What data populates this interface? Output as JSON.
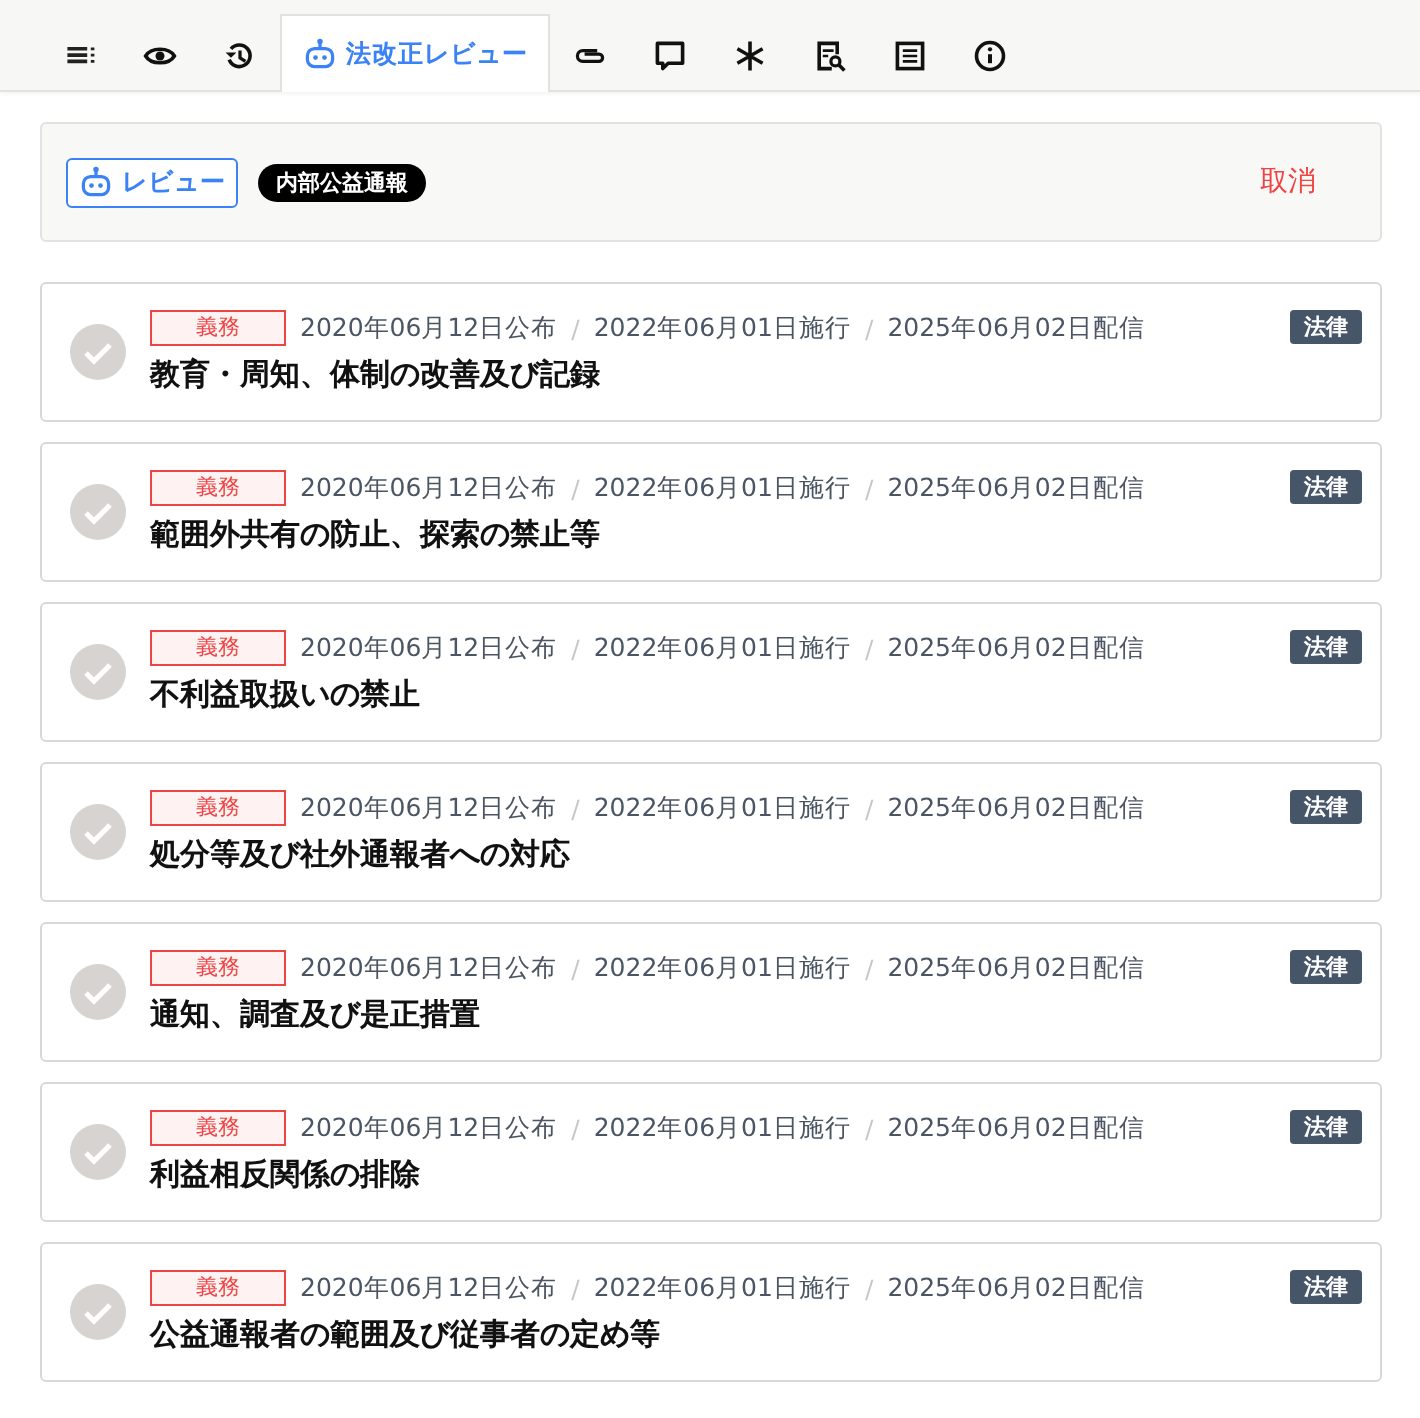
{
  "tabs": [
    {
      "selected": false
    },
    {
      "selected": false
    },
    {
      "selected": false
    },
    {
      "selected": true,
      "label": "法改正レビュー"
    },
    {
      "selected": false
    },
    {
      "selected": false
    },
    {
      "selected": false
    },
    {
      "selected": false
    },
    {
      "selected": false
    },
    {
      "selected": false
    }
  ],
  "review_bar": {
    "review_button": "レビュー",
    "category": "内部公益通報",
    "cancel": "取消"
  },
  "items": [
    {
      "done": false,
      "tag": "義務",
      "meta": [
        {
          "kind": "date",
          "text": "2020年06月12日公布"
        },
        {
          "kind": "sep",
          "text": "/"
        },
        {
          "kind": "date",
          "text": "2022年06月01日施行"
        },
        {
          "kind": "sep",
          "text": "/"
        },
        {
          "kind": "date",
          "text": "2025年06月02日配信"
        }
      ],
      "type": "法律",
      "title": "教育・周知、体制の改善及び記録"
    },
    {
      "done": false,
      "tag": "義務",
      "meta": [
        {
          "kind": "date",
          "text": "2020年06月12日公布"
        },
        {
          "kind": "sep",
          "text": "/"
        },
        {
          "kind": "date",
          "text": "2022年06月01日施行"
        },
        {
          "kind": "sep",
          "text": "/"
        },
        {
          "kind": "date",
          "text": "2025年06月02日配信"
        }
      ],
      "type": "法律",
      "title": "範囲外共有の防止、探索の禁止等"
    },
    {
      "done": false,
      "tag": "義務",
      "meta": [
        {
          "kind": "date",
          "text": "2020年06月12日公布"
        },
        {
          "kind": "sep",
          "text": "/"
        },
        {
          "kind": "date",
          "text": "2022年06月01日施行"
        },
        {
          "kind": "sep",
          "text": "/"
        },
        {
          "kind": "date",
          "text": "2025年06月02日配信"
        }
      ],
      "type": "法律",
      "title": "不利益取扱いの禁止"
    },
    {
      "done": false,
      "tag": "義務",
      "meta": [
        {
          "kind": "date",
          "text": "2020年06月12日公布"
        },
        {
          "kind": "sep",
          "text": "/"
        },
        {
          "kind": "date",
          "text": "2022年06月01日施行"
        },
        {
          "kind": "sep",
          "text": "/"
        },
        {
          "kind": "date",
          "text": "2025年06月02日配信"
        }
      ],
      "type": "法律",
      "title": "処分等及び社外通報者への対応"
    },
    {
      "done": false,
      "tag": "義務",
      "meta": [
        {
          "kind": "date",
          "text": "2020年06月12日公布"
        },
        {
          "kind": "sep",
          "text": "/"
        },
        {
          "kind": "date",
          "text": "2022年06月01日施行"
        },
        {
          "kind": "sep",
          "text": "/"
        },
        {
          "kind": "date",
          "text": "2025年06月02日配信"
        }
      ],
      "type": "法律",
      "title": "通知、調査及び是正措置"
    },
    {
      "done": false,
      "tag": "義務",
      "meta": [
        {
          "kind": "date",
          "text": "2020年06月12日公布"
        },
        {
          "kind": "sep",
          "text": "/"
        },
        {
          "kind": "date",
          "text": "2022年06月01日施行"
        },
        {
          "kind": "sep",
          "text": "/"
        },
        {
          "kind": "date",
          "text": "2025年06月02日配信"
        }
      ],
      "type": "法律",
      "title": "利益相反関係の排除"
    },
    {
      "done": false,
      "tag": "義務",
      "meta": [
        {
          "kind": "date",
          "text": "2020年06月12日公布"
        },
        {
          "kind": "sep",
          "text": "/"
        },
        {
          "kind": "date",
          "text": "2022年06月01日施行"
        },
        {
          "kind": "sep",
          "text": "/"
        },
        {
          "kind": "date",
          "text": "2025年06月02日配信"
        }
      ],
      "type": "法律",
      "title": "公益通報者の範囲及び従事者の定め等"
    }
  ]
}
